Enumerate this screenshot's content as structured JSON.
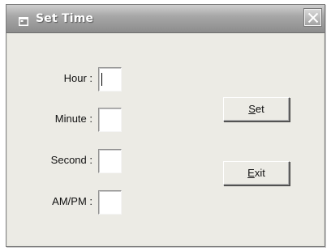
{
  "window": {
    "title": "Set Time",
    "icon": "app-window-icon",
    "close_icon": "close-icon"
  },
  "form": {
    "hour_label": "Hour :",
    "minute_label": "Minute :",
    "second_label": "Second :",
    "ampm_label": "AM/PM :",
    "hour_value": "",
    "minute_value": "",
    "second_value": "",
    "ampm_value": ""
  },
  "buttons": {
    "set": {
      "accel": "S",
      "rest": "et"
    },
    "exit": {
      "accel": "E",
      "rest": "xit"
    }
  }
}
